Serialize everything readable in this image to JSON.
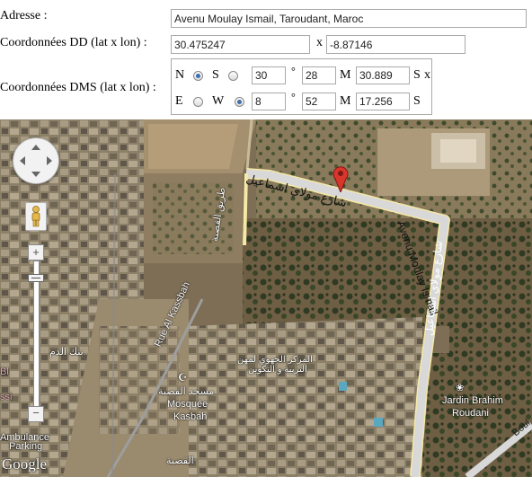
{
  "form": {
    "address_label": "Adresse :",
    "address_value": "Avenu Moulay Ismail, Taroudant, Maroc",
    "dd_label": "Coordonnées DD (lat x lon) :",
    "dd_lat": "30.475247",
    "dd_x": "x",
    "dd_lon": "-8.87146",
    "dms_label": "Coordonnées DMS (lat x lon) :",
    "dms": {
      "lat": {
        "n_label": "N",
        "s_label": "S",
        "selected": "N",
        "deg": "30",
        "deg_unit": "°",
        "min": "28",
        "min_unit": "M",
        "sec": "30.889",
        "sec_unit": "S",
        "x": "x"
      },
      "lon": {
        "e_label": "E",
        "w_label": "W",
        "selected": "W",
        "deg": "8",
        "deg_unit": "°",
        "min": "52",
        "min_unit": "M",
        "sec": "17.256",
        "sec_unit": "S"
      }
    }
  },
  "map": {
    "road_main_ar": "شارع مولاي اسماعيل",
    "road_main_fr": "Avenu Moulay Ismail",
    "road_vertical_ar": "شارع مولاي اسماعيل",
    "road_kasbah_fr": "Rue Al Kassbah",
    "road_kasbah_ar": "طريق القصبة",
    "poi_mosque_ar": "مسجد القصبة",
    "poi_mosque_fr1": "Mosquée",
    "poi_mosque_fr2": "Kasbah",
    "poi_garden1": "Jardin Brahim",
    "poi_garden2": "Roudani",
    "poi_bank_ar": "بنك الدم",
    "poi_center_ar1": "المركز الجهوي لمهن",
    "poi_center_ar2": "التربية و التكوين",
    "poi_ambulance1": "Ambulance",
    "poi_ambulance2": "Parking",
    "poi_left1": "ssi",
    "poi_left2": "Bl",
    "poi_bottom_ar": "القصبة",
    "poi_boul": "Boul",
    "google_logo": "Google",
    "colors": {
      "road_fill": "#d8d8d8",
      "road_edge": "#f6e9a6",
      "marker": "#d9362b"
    }
  }
}
